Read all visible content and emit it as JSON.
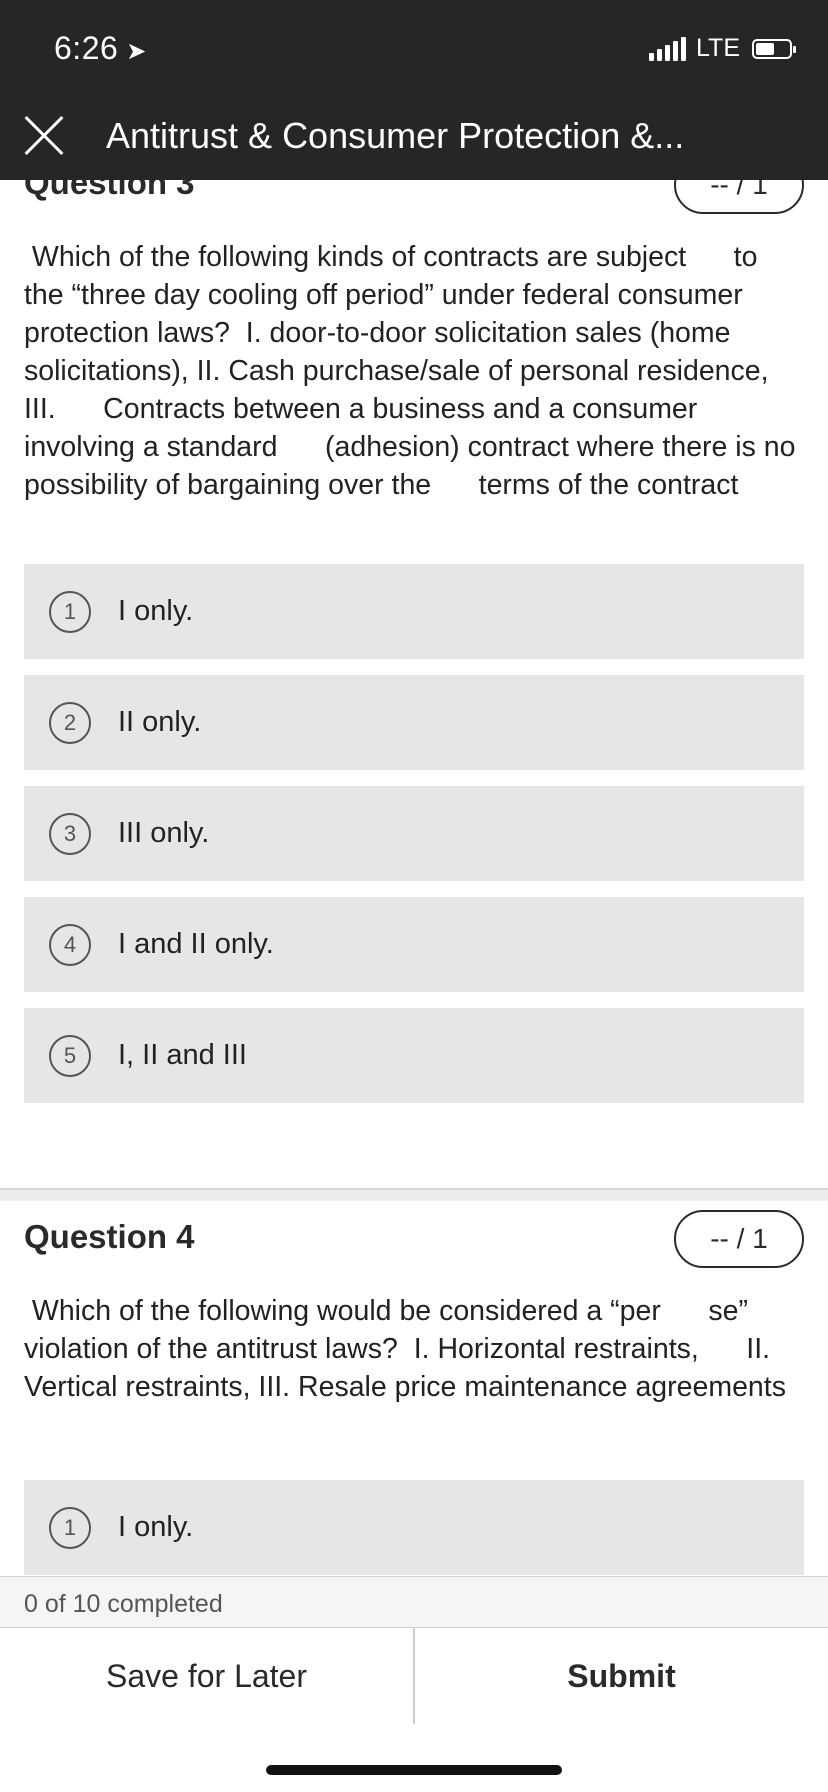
{
  "status_bar": {
    "time": "6:26",
    "network": "LTE"
  },
  "header": {
    "title": "Antitrust & Consumer Protection &..."
  },
  "questions": [
    {
      "title": "Question 3",
      "score": "-- / 1",
      "text": " Which of the following kinds of contracts are subject      to the “three day cooling off period” under federal consumer protection laws?  I. door-to-door solicitation sales (home solicitations), II. Cash purchase/sale of personal residence, III.      Contracts between a business and a consumer involving a standard      (adhesion) contract where there is no possibility of bargaining over the      terms of the contract",
      "options": [
        {
          "num": "1",
          "label": "I only."
        },
        {
          "num": "2",
          "label": "II only."
        },
        {
          "num": "3",
          "label": "III only."
        },
        {
          "num": "4",
          "label": "I and II only."
        },
        {
          "num": "5",
          "label": "I, II and III"
        }
      ]
    },
    {
      "title": "Question 4",
      "score": "-- / 1",
      "text": " Which of the following would be considered a “per      se” violation of the antitrust laws?  I. Horizontal restraints,      II. Vertical restraints, III. Resale price maintenance agreements",
      "options": [
        {
          "num": "1",
          "label": "I only."
        }
      ]
    }
  ],
  "progress": {
    "label": "0 of 10 completed"
  },
  "footer": {
    "save_label": "Save for Later",
    "submit_label": "Submit"
  },
  "icons": {
    "close": "close-icon",
    "location": "location-arrow-icon",
    "signal": "signal-icon",
    "battery": "battery-icon"
  }
}
